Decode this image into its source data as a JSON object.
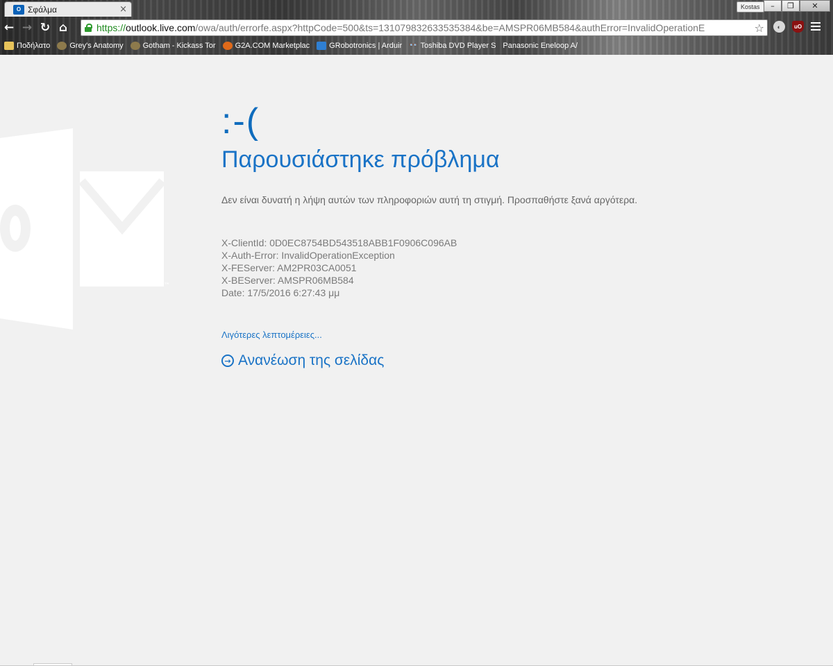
{
  "browser": {
    "tab": {
      "title": "Σφάλμα",
      "favicon_text": "O",
      "close_glyph": "×"
    },
    "user_badge": "Kostas",
    "window_buttons": {
      "minimize": "–",
      "restore": "❐",
      "close": "✕"
    },
    "nav": {
      "back": "←",
      "forward": "→",
      "reload": "↻",
      "home": "⌂"
    },
    "address": {
      "scheme": "https://",
      "host": "outlook.live.com",
      "path": "/owa/auth/errorfe.aspx?httpCode=500&ts=131079832633535384&be=AMSPR06MB584&authError=InvalidOperationE"
    },
    "star_glyph": "☆",
    "extensions": {
      "ext1": "◐",
      "ublock": "uO"
    },
    "bookmarks": [
      {
        "label": "Ποδήλατο",
        "icon": "folder-icon"
      },
      {
        "label": "Grey's Anatomy",
        "icon": "tpb-icon"
      },
      {
        "label": "Gotham - Kickass Tor",
        "icon": "tpb-icon"
      },
      {
        "label": "G2A.COM Marketplac",
        "icon": "g2a-icon"
      },
      {
        "label": "GRobotronics | Arduir",
        "icon": "gear-icon"
      },
      {
        "label": "Toshiba DVD Player S",
        "icon": "glasses-icon"
      },
      {
        "label": "Panasonic Eneloop A/",
        "icon": ""
      }
    ]
  },
  "error_page": {
    "sad_face": ":-(",
    "heading": "Παρουσιάστηκε πρόβλημα",
    "message": "Δεν είναι δυνατή η λήψη αυτών των πληροφοριών αυτή τη στιγμή. Προσπαθήστε ξανά αργότερα.",
    "details": [
      "X-ClientId: 0D0EC8754BD543518ABB1F0906C096AB",
      "X-Auth-Error: InvalidOperationException",
      "X-FEServer: AM2PR03CA0051",
      "X-BEServer: AMSPR06MB584",
      "Date: 17/5/2016 6:27:43 μμ"
    ],
    "less_details_link": "Λιγότερες λεπτομέρειες...",
    "refresh_link": "Ανανέωση της σελίδας",
    "accent_color": "#1a73c6"
  }
}
